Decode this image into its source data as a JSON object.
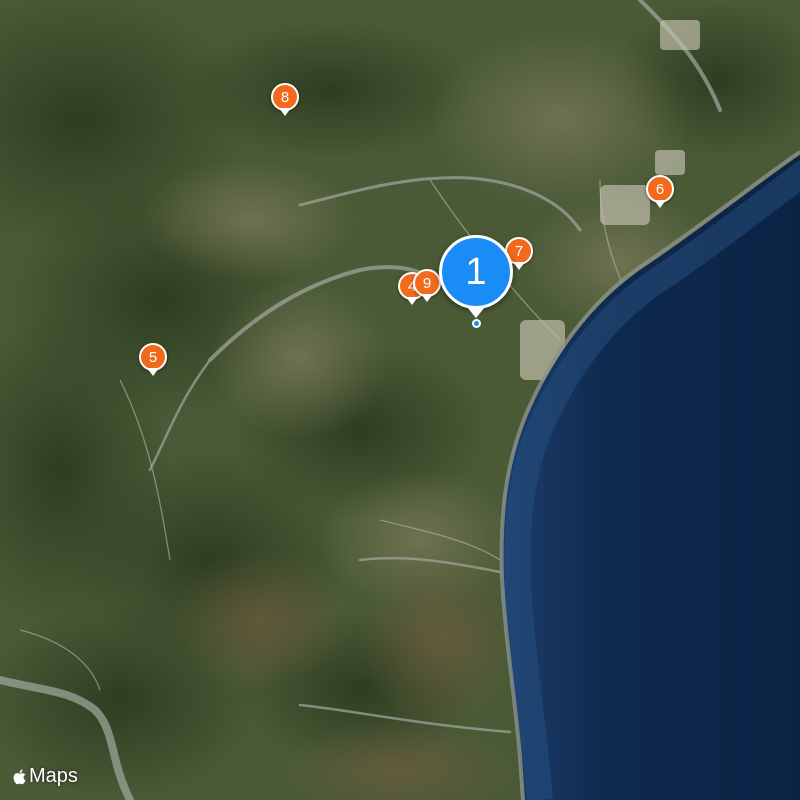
{
  "map": {
    "type": "satellite",
    "colors": {
      "land": "#4a5a36",
      "sea": "#0f2a4f",
      "coast": "#7d8a83",
      "pin": "#f26a1b",
      "cluster": "#1a8cf5"
    },
    "cluster_pin": {
      "label": "1"
    },
    "pins": [
      {
        "label": "8"
      },
      {
        "label": "6"
      },
      {
        "label": "7"
      },
      {
        "label": "4"
      },
      {
        "label": "9"
      },
      {
        "label": "5"
      }
    ]
  },
  "attribution": {
    "label": "Maps",
    "icon": "apple-logo-icon"
  }
}
